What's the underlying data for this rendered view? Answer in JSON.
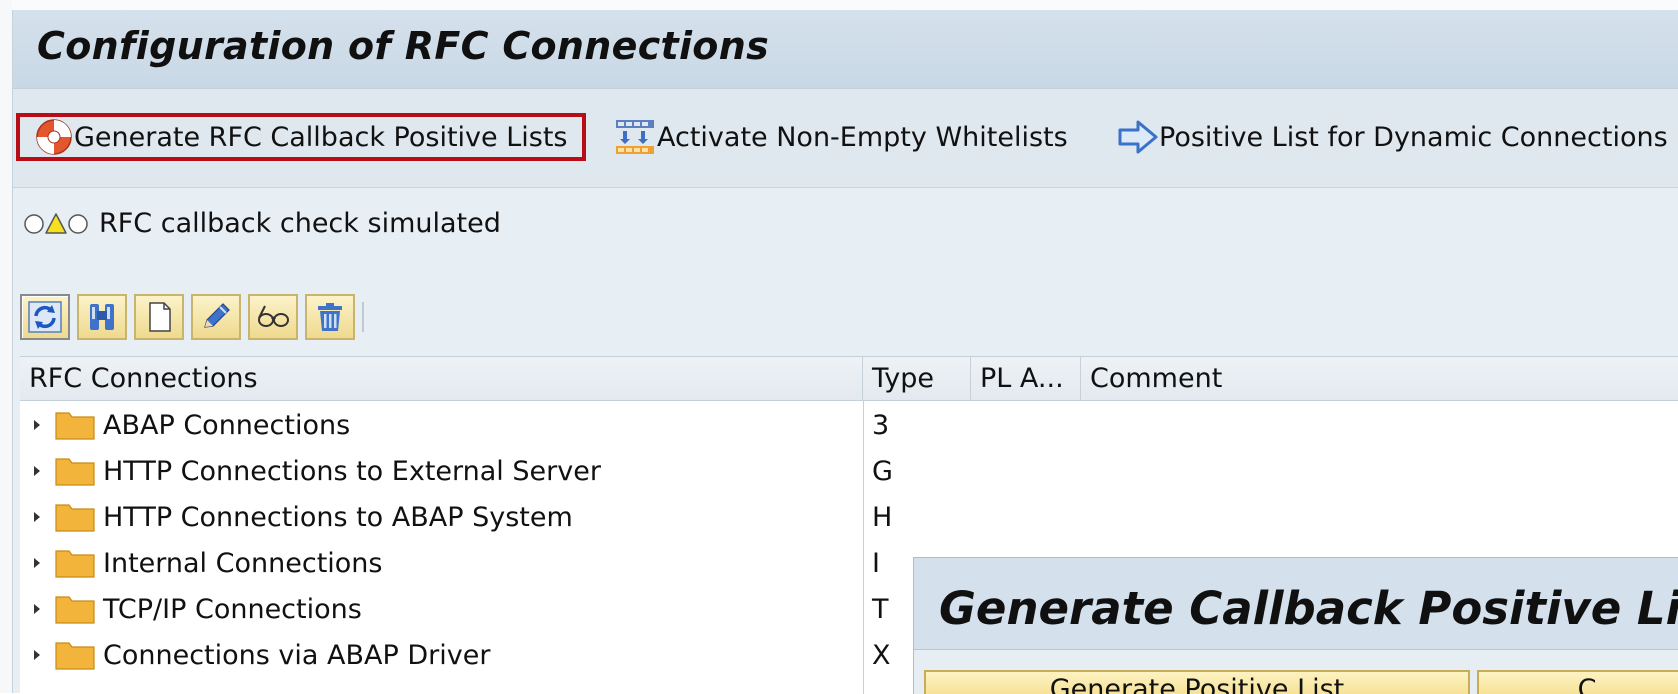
{
  "window": {
    "title": "Configuration of RFC Connections"
  },
  "app_toolbar": {
    "generate_callback_lists": "Generate RFC Callback Positive Lists",
    "activate_whitelists": "Activate Non-Empty Whitelists",
    "positive_list_dynamic": "Positive List for Dynamic Connections"
  },
  "status": {
    "text": "RFC callback check simulated"
  },
  "tree_toolbar": {
    "icons": [
      "refresh-icon",
      "find-icon",
      "create-icon",
      "edit-icon",
      "display-icon",
      "delete-icon"
    ]
  },
  "grid": {
    "columns": [
      "RFC Connections",
      "Type",
      "PL A...",
      "Comment"
    ],
    "rows": [
      {
        "name": "ABAP Connections",
        "type": "3"
      },
      {
        "name": "HTTP Connections to External Server",
        "type": "G"
      },
      {
        "name": "HTTP Connections to ABAP System",
        "type": "H"
      },
      {
        "name": "Internal Connections",
        "type": "I"
      },
      {
        "name": "TCP/IP Connections",
        "type": "T"
      },
      {
        "name": "Connections via ABAP Driver",
        "type": "X"
      }
    ]
  },
  "popup": {
    "title": "Generate Callback Positive Lis",
    "button_generate": "Generate Positive List",
    "button_second": "C"
  },
  "colors": {
    "highlight_border": "#b70d16",
    "button_fill": "#efd98e",
    "folder": "#f2b43a",
    "title_bar": "#c9d8e6"
  }
}
